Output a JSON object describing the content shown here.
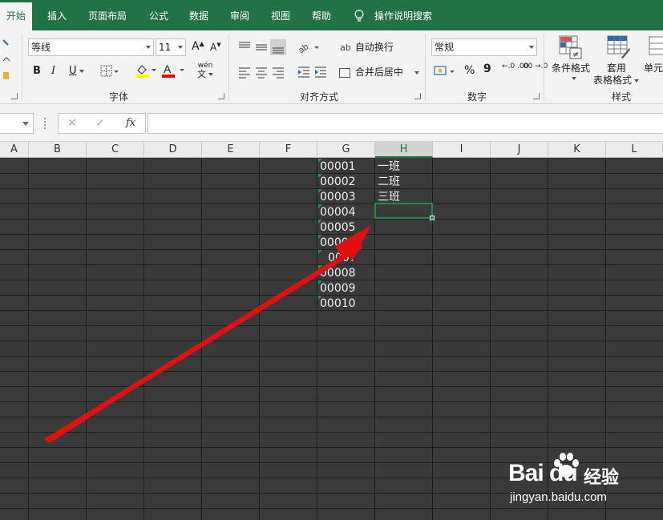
{
  "tabs": [
    {
      "label": "开始",
      "active": true
    },
    {
      "label": "插入",
      "active": false
    },
    {
      "label": "页面布局",
      "active": false
    },
    {
      "label": "公式",
      "active": false
    },
    {
      "label": "数据",
      "active": false
    },
    {
      "label": "审阅",
      "active": false
    },
    {
      "label": "视图",
      "active": false
    },
    {
      "label": "帮助",
      "active": false
    }
  ],
  "tell_me": "操作说明搜索",
  "ribbon": {
    "font_name": "等线",
    "font_size": "11",
    "bold": "B",
    "italic": "I",
    "underline": "U",
    "phonetic_top": "wén",
    "phonetic_bottom": "文",
    "wrap_text": "自动换行",
    "merge_center": "合并后居中",
    "number_format": "常规",
    "percent": "%",
    "comma": "9",
    "inc_decimal": "←.0 .00",
    "dec_decimal": ".00 →.0",
    "conditional_format": "条件格式",
    "table_format_1": "套用",
    "table_format_2": "表格格式",
    "cell_styles": "单元",
    "groups": {
      "font": "字体",
      "alignment": "对齐方式",
      "number": "数字",
      "styles": "样式"
    },
    "colors": {
      "highlight": "#ffff00",
      "font_color": "#ff0000"
    }
  },
  "formula_bar": {
    "fx": "fx",
    "cancel": "✕",
    "enter": "✓"
  },
  "columns": [
    "A",
    "B",
    "C",
    "D",
    "E",
    "F",
    "G",
    "H",
    "I",
    "J",
    "K",
    "L"
  ],
  "selected_column": "H",
  "cells": {
    "G": [
      "00001",
      "00002",
      "00003",
      "00004",
      "00005",
      "0000",
      "0007",
      "00008",
      "00009",
      "00010"
    ],
    "H": [
      "一班",
      "二班",
      "三班"
    ]
  },
  "watermark": {
    "brand": "Bai du",
    "cn": "经验",
    "url": "jingyan.baidu.com"
  },
  "colors": {
    "accent": "#217346",
    "arrow": "#e01010",
    "grid_bg": "#3a3a3a"
  }
}
